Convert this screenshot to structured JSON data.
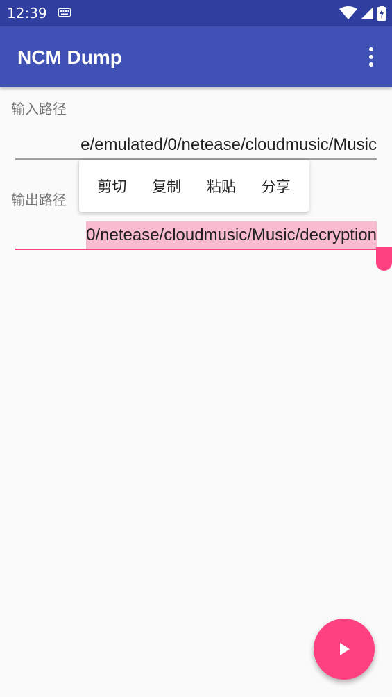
{
  "status_bar": {
    "time": "12:39",
    "icons": [
      "keyboard-icon",
      "wifi-icon",
      "cellular-signal-icon",
      "battery-charging-icon"
    ],
    "background": "#303f9f"
  },
  "app_bar": {
    "title": "NCM Dump",
    "background": "#3f51b5",
    "overflow_icon": "more-vert-icon"
  },
  "input_path": {
    "label": "输入路径",
    "value": "e/emulated/0/netease/cloudmusic/Music"
  },
  "output_path": {
    "label": "输出路径",
    "value": "0/netease/cloudmusic/Music/decryption",
    "selected": true
  },
  "context_menu": {
    "items": [
      "剪切",
      "复制",
      "粘贴",
      "分享"
    ]
  },
  "fab": {
    "icon": "play-icon",
    "color": "#ff4081"
  },
  "colors": {
    "accent": "#ff4081",
    "selection_highlight": "#f8bbd0",
    "background": "#fafafa"
  }
}
